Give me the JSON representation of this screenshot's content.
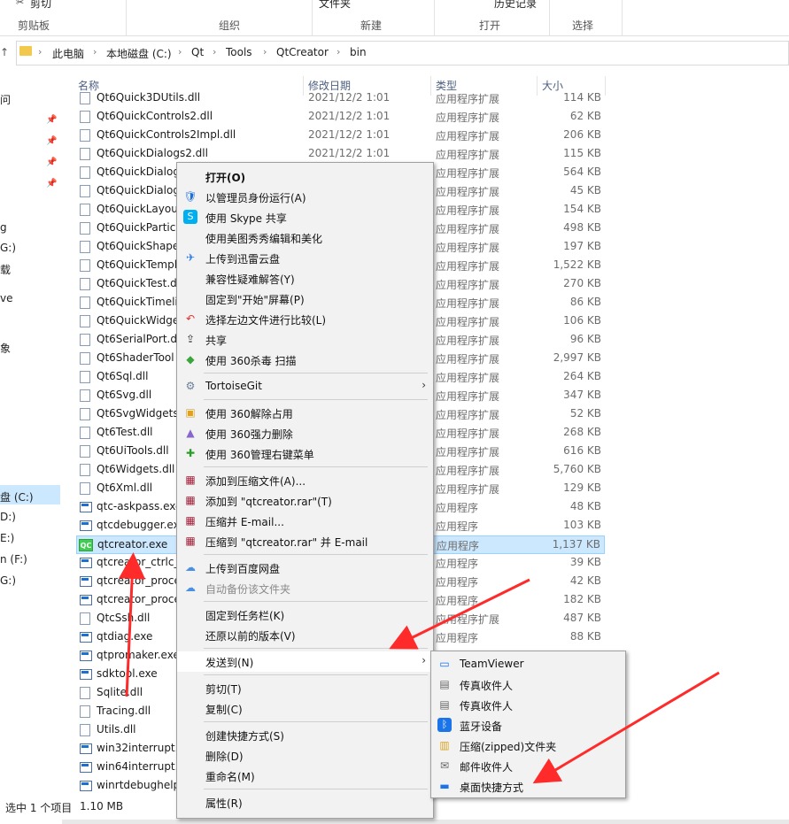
{
  "ribbon": {
    "cut": "剪切",
    "top_items": [
      "文件夹",
      "历史记录"
    ],
    "groups": [
      "剪贴板",
      "组织",
      "新建",
      "打开",
      "选择"
    ]
  },
  "address": {
    "crumbs": [
      "此电脑",
      "本地磁盘 (C:)",
      "Qt",
      "Tools",
      "QtCreator",
      "bin"
    ]
  },
  "nav": {
    "items": [
      "问",
      "g",
      "G:)",
      "载",
      "ve",
      "象",
      "盘 (C:)",
      "D:)",
      "E:)",
      "n (F:)",
      "G:)"
    ]
  },
  "columns": [
    "名称",
    "修改日期",
    "类型",
    "大小"
  ],
  "files": [
    {
      "name": "Qt6Quick3DUtils.dll",
      "date": "2021/12/2 1:01",
      "type": "应用程序扩展",
      "size": "114 KB",
      "icon": "dll"
    },
    {
      "name": "Qt6QuickControls2.dll",
      "date": "2021/12/2 1:01",
      "type": "应用程序扩展",
      "size": "62 KB",
      "icon": "dll"
    },
    {
      "name": "Qt6QuickControls2Impl.dll",
      "date": "2021/12/2 1:01",
      "type": "应用程序扩展",
      "size": "206 KB",
      "icon": "dll"
    },
    {
      "name": "Qt6QuickDialogs2.dll",
      "date": "2021/12/2 1:01",
      "type": "应用程序扩展",
      "size": "115 KB",
      "icon": "dll"
    },
    {
      "name": "Qt6QuickDialog",
      "date": "",
      "type": "应用程序扩展",
      "size": "564 KB",
      "icon": "dll"
    },
    {
      "name": "Qt6QuickDialog",
      "date": "",
      "type": "应用程序扩展",
      "size": "45 KB",
      "icon": "dll"
    },
    {
      "name": "Qt6QuickLayou",
      "date": "",
      "type": "应用程序扩展",
      "size": "154 KB",
      "icon": "dll"
    },
    {
      "name": "Qt6QuickParticl",
      "date": "",
      "type": "应用程序扩展",
      "size": "498 KB",
      "icon": "dll"
    },
    {
      "name": "Qt6QuickShape",
      "date": "",
      "type": "应用程序扩展",
      "size": "197 KB",
      "icon": "dll"
    },
    {
      "name": "Qt6QuickTempl",
      "date": "",
      "type": "应用程序扩展",
      "size": "1,522 KB",
      "icon": "dll"
    },
    {
      "name": "Qt6QuickTest.d",
      "date": "",
      "type": "应用程序扩展",
      "size": "270 KB",
      "icon": "dll"
    },
    {
      "name": "Qt6QuickTimeli",
      "date": "",
      "type": "应用程序扩展",
      "size": "86 KB",
      "icon": "dll"
    },
    {
      "name": "Qt6QuickWidge",
      "date": "",
      "type": "应用程序扩展",
      "size": "106 KB",
      "icon": "dll"
    },
    {
      "name": "Qt6SerialPort.d",
      "date": "",
      "type": "应用程序扩展",
      "size": "96 KB",
      "icon": "dll"
    },
    {
      "name": "Qt6ShaderTool",
      "date": "",
      "type": "应用程序扩展",
      "size": "2,997 KB",
      "icon": "dll"
    },
    {
      "name": "Qt6Sql.dll",
      "date": "",
      "type": "应用程序扩展",
      "size": "264 KB",
      "icon": "dll"
    },
    {
      "name": "Qt6Svg.dll",
      "date": "",
      "type": "应用程序扩展",
      "size": "347 KB",
      "icon": "dll"
    },
    {
      "name": "Qt6SvgWidgets",
      "date": "",
      "type": "应用程序扩展",
      "size": "52 KB",
      "icon": "dll"
    },
    {
      "name": "Qt6Test.dll",
      "date": "",
      "type": "应用程序扩展",
      "size": "268 KB",
      "icon": "dll"
    },
    {
      "name": "Qt6UiTools.dll",
      "date": "",
      "type": "应用程序扩展",
      "size": "616 KB",
      "icon": "dll"
    },
    {
      "name": "Qt6Widgets.dll",
      "date": "",
      "type": "应用程序扩展",
      "size": "5,760 KB",
      "icon": "dll"
    },
    {
      "name": "Qt6Xml.dll",
      "date": "",
      "type": "应用程序扩展",
      "size": "129 KB",
      "icon": "dll"
    },
    {
      "name": "qtc-askpass.exe",
      "date": "",
      "type": "应用程序",
      "size": "48 KB",
      "icon": "exe"
    },
    {
      "name": "qtcdebugger.exe",
      "date": "",
      "type": "应用程序",
      "size": "103 KB",
      "icon": "exe"
    },
    {
      "name": "qtcreator.exe",
      "date": "",
      "type": "应用程序",
      "size": "1,137 KB",
      "icon": "qt"
    },
    {
      "name": "qtcreator_ctrlc_",
      "date": "",
      "type": "应用程序",
      "size": "39 KB",
      "icon": "exe"
    },
    {
      "name": "qtcreator_proce",
      "date": "",
      "type": "应用程序",
      "size": "42 KB",
      "icon": "exe"
    },
    {
      "name": "qtcreator_proce",
      "date": "",
      "type": "应用程序",
      "size": "182 KB",
      "icon": "exe"
    },
    {
      "name": "QtcSsh.dll",
      "date": "",
      "type": "应用程序扩展",
      "size": "487 KB",
      "icon": "dll"
    },
    {
      "name": "qtdiag.exe",
      "date": "",
      "type": "应用程序",
      "size": "88 KB",
      "icon": "exe"
    },
    {
      "name": "qtpromaker.exe",
      "date": "",
      "type": "",
      "size": "",
      "icon": "exe"
    },
    {
      "name": "sdktool.exe",
      "date": "",
      "type": "",
      "size": "",
      "icon": "exe"
    },
    {
      "name": "Sqlite.dll",
      "date": "",
      "type": "",
      "size": "",
      "icon": "dll"
    },
    {
      "name": "Tracing.dll",
      "date": "",
      "type": "",
      "size": "",
      "icon": "dll"
    },
    {
      "name": "Utils.dll",
      "date": "",
      "type": "",
      "size": "",
      "icon": "dll"
    },
    {
      "name": "win32interrupt.e",
      "date": "",
      "type": "",
      "size": "",
      "icon": "exe"
    },
    {
      "name": "win64interrupt.e",
      "date": "",
      "type": "",
      "size": "",
      "icon": "exe"
    },
    {
      "name": "winrtdebughelp",
      "date": "",
      "type": "",
      "size": "",
      "icon": "exe"
    }
  ],
  "status": {
    "selected": "选中 1 个项目",
    "size": "1.10 MB"
  },
  "context_menu": {
    "items": [
      {
        "label": "打开(O)",
        "icon": "",
        "bold": true
      },
      {
        "label": "以管理员身份运行(A)",
        "icon": "shield-icon"
      },
      {
        "label": "使用 Skype 共享",
        "icon": "skype-icon"
      },
      {
        "label": "使用美图秀秀编辑和美化",
        "icon": ""
      },
      {
        "label": "上传到迅雷云盘",
        "icon": "thunder-icon"
      },
      {
        "label": "兼容性疑难解答(Y)",
        "icon": ""
      },
      {
        "label": "固定到\"开始\"屏幕(P)",
        "icon": ""
      },
      {
        "label": "选择左边文件进行比较(L)",
        "icon": "compare-icon"
      },
      {
        "label": "共享",
        "icon": "share-icon"
      },
      {
        "label": "使用 360杀毒 扫描",
        "icon": "360-shield-icon"
      },
      {
        "sep": true
      },
      {
        "label": "TortoiseGit",
        "icon": "tortoisegit-icon",
        "submenu": true
      },
      {
        "sep": true
      },
      {
        "label": "使用 360解除占用",
        "icon": "360-unlock-icon"
      },
      {
        "label": "使用 360强力删除",
        "icon": "360-delete-icon"
      },
      {
        "label": "使用 360管理右键菜单",
        "icon": "360-menu-icon"
      },
      {
        "sep": true
      },
      {
        "label": "添加到压缩文件(A)...",
        "icon": "winrar-icon"
      },
      {
        "label": "添加到 \"qtcreator.rar\"(T)",
        "icon": "winrar-icon"
      },
      {
        "label": "压缩并 E-mail...",
        "icon": "winrar-icon"
      },
      {
        "label": "压缩到 \"qtcreator.rar\" 并 E-mail",
        "icon": "winrar-icon"
      },
      {
        "sep": true
      },
      {
        "label": "上传到百度网盘",
        "icon": "baidu-cloud-icon"
      },
      {
        "label": "自动备份该文件夹",
        "icon": "baidu-cloud-icon",
        "dim": true
      },
      {
        "sep": true
      },
      {
        "label": "固定到任务栏(K)",
        "icon": ""
      },
      {
        "label": "还原以前的版本(V)",
        "icon": ""
      },
      {
        "sep": true
      },
      {
        "label": "发送到(N)",
        "icon": "",
        "submenu": true,
        "hover": true
      },
      {
        "sep": true
      },
      {
        "label": "剪切(T)",
        "icon": ""
      },
      {
        "label": "复制(C)",
        "icon": ""
      },
      {
        "sep": true
      },
      {
        "label": "创建快捷方式(S)",
        "icon": ""
      },
      {
        "label": "删除(D)",
        "icon": ""
      },
      {
        "label": "重命名(M)",
        "icon": ""
      },
      {
        "sep": true
      },
      {
        "label": "属性(R)",
        "icon": ""
      }
    ]
  },
  "sendto_menu": {
    "items": [
      {
        "label": "TeamViewer",
        "icon": "teamviewer-icon"
      },
      {
        "label": "传真收件人",
        "icon": "fax-icon"
      },
      {
        "label": "传真收件人",
        "icon": "fax-icon"
      },
      {
        "label": "蓝牙设备",
        "icon": "bluetooth-icon"
      },
      {
        "label": "压缩(zipped)文件夹",
        "icon": "zip-folder-icon"
      },
      {
        "label": "邮件收件人",
        "icon": "mail-icon"
      },
      {
        "label": "桌面快捷方式",
        "icon": "desktop-icon"
      }
    ]
  },
  "colors": {
    "accent": "#cce8ff",
    "arrow": "#ff2a2a"
  }
}
